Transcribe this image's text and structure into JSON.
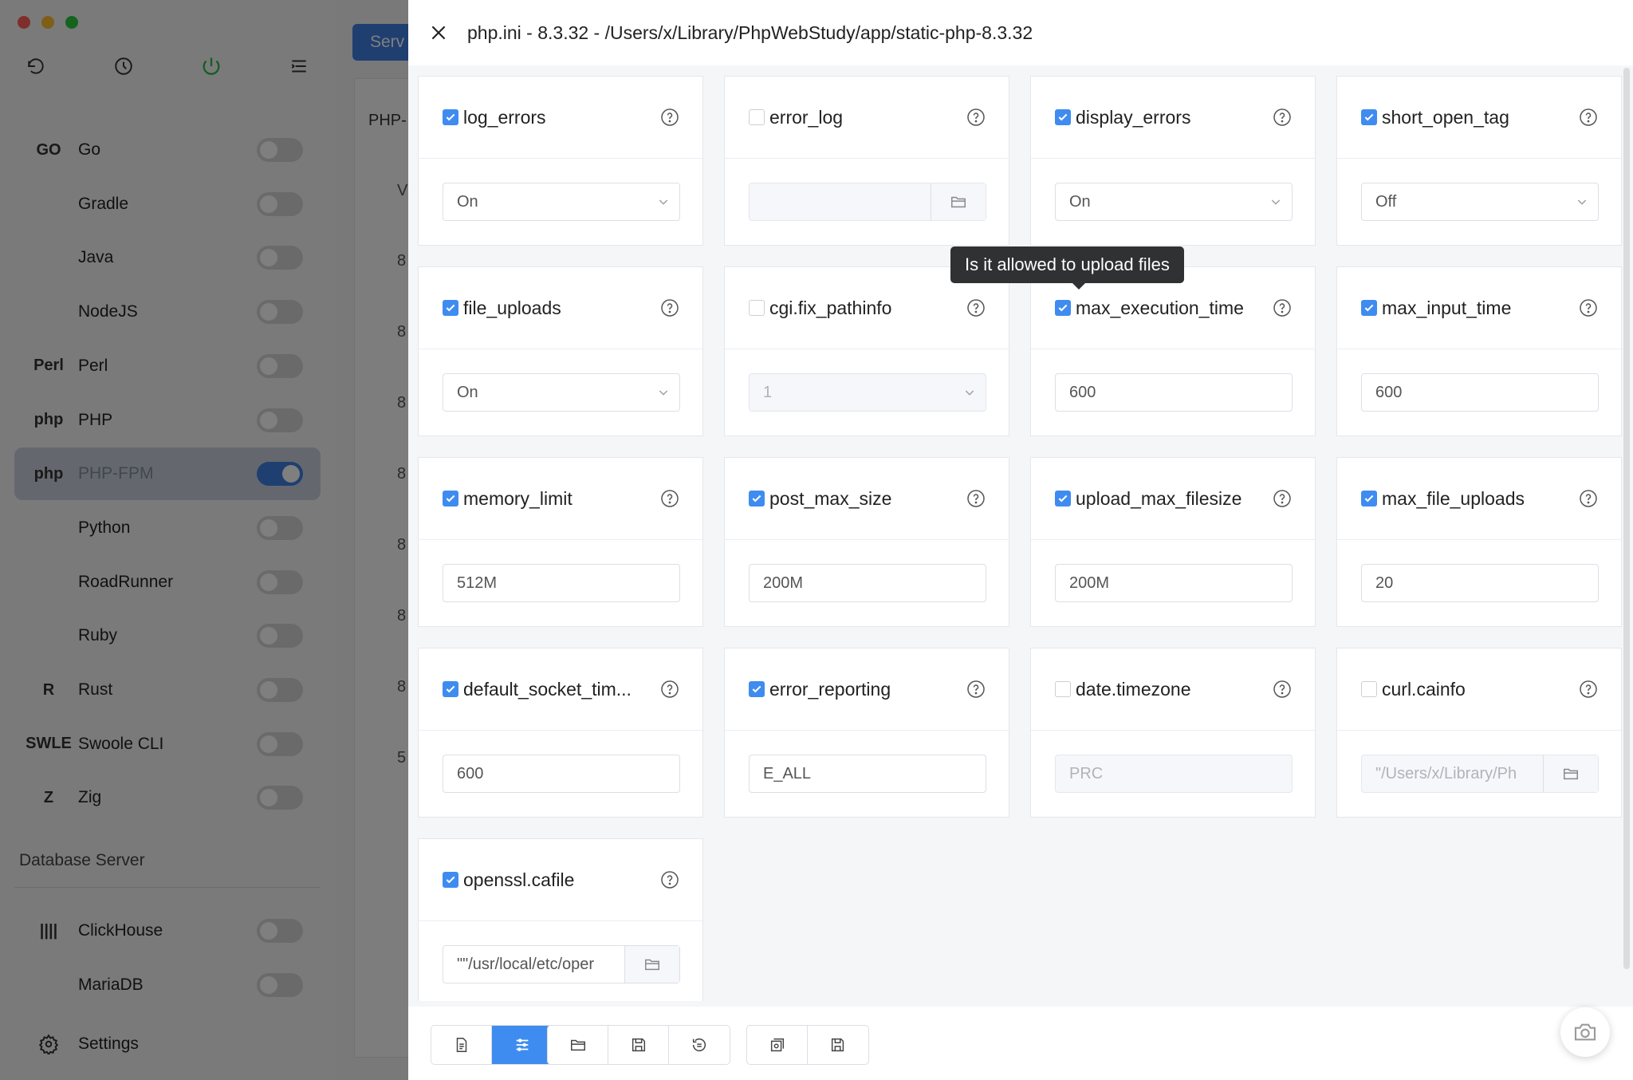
{
  "drawer": {
    "title": "php.ini - 8.3.32 - /Users/x/Library/PhpWebStudy/app/static-php-8.3.32"
  },
  "sidebar": {
    "items": [
      {
        "name": "Go",
        "icon": "go-icon",
        "icon_text": "GO",
        "active": false
      },
      {
        "name": "Gradle",
        "icon": "gradle-icon",
        "icon_text": "",
        "active": false
      },
      {
        "name": "Java",
        "icon": "java-icon",
        "icon_text": "",
        "active": false
      },
      {
        "name": "NodeJS",
        "icon": "nodejs-icon",
        "icon_text": "",
        "active": false
      },
      {
        "name": "Perl",
        "icon": "perl-icon",
        "icon_text": "Perl",
        "active": false
      },
      {
        "name": "PHP",
        "icon": "php-icon",
        "icon_text": "php",
        "active": false
      },
      {
        "name": "PHP-FPM",
        "icon": "php-fpm-icon",
        "icon_text": "php",
        "active": true
      },
      {
        "name": "Python",
        "icon": "python-icon",
        "icon_text": "",
        "active": false
      },
      {
        "name": "RoadRunner",
        "icon": "roadrunner-icon",
        "icon_text": "",
        "active": false
      },
      {
        "name": "Ruby",
        "icon": "ruby-icon",
        "icon_text": "",
        "active": false
      },
      {
        "name": "Rust",
        "icon": "rust-icon",
        "icon_text": "R",
        "active": false
      },
      {
        "name": "Swoole CLI",
        "icon": "swoole-icon",
        "icon_text": "SWLE",
        "active": false
      },
      {
        "name": "Zig",
        "icon": "zig-icon",
        "icon_text": "Z",
        "active": false
      }
    ],
    "section_database": "Database Server",
    "db_items": [
      {
        "name": "ClickHouse",
        "icon": "clickhouse-icon",
        "icon_text": "||||"
      },
      {
        "name": "MariaDB",
        "icon": "mariadb-icon",
        "icon_text": ""
      }
    ],
    "settings": "Settings"
  },
  "main": {
    "serv_button": "Serv",
    "php_tab": "PHP-",
    "column_v": "V",
    "row_values": [
      "8",
      "8",
      "8",
      "8",
      "8",
      "8",
      "8",
      "5"
    ]
  },
  "settings_cards": [
    {
      "key": "log_errors",
      "checked": true,
      "type": "select",
      "value": "On",
      "disabled": false
    },
    {
      "key": "error_log",
      "checked": false,
      "type": "file",
      "value": "",
      "disabled": true
    },
    {
      "key": "display_errors",
      "checked": true,
      "type": "select",
      "value": "On",
      "disabled": false
    },
    {
      "key": "short_open_tag",
      "checked": true,
      "type": "select",
      "value": "Off",
      "disabled": false
    },
    {
      "key": "file_uploads",
      "checked": true,
      "type": "select",
      "value": "On",
      "disabled": false
    },
    {
      "key": "cgi.fix_pathinfo",
      "checked": false,
      "type": "select",
      "value": "1",
      "disabled": true
    },
    {
      "key": "max_execution_time",
      "checked": true,
      "type": "input",
      "value": "600",
      "disabled": false
    },
    {
      "key": "max_input_time",
      "checked": true,
      "type": "input",
      "value": "600",
      "disabled": false
    },
    {
      "key": "memory_limit",
      "checked": true,
      "type": "input",
      "value": "512M",
      "disabled": false
    },
    {
      "key": "post_max_size",
      "checked": true,
      "type": "input",
      "value": "200M",
      "disabled": false
    },
    {
      "key": "upload_max_filesize",
      "checked": true,
      "type": "input",
      "value": "200M",
      "disabled": false
    },
    {
      "key": "max_file_uploads",
      "checked": true,
      "type": "input",
      "value": "20",
      "disabled": false
    },
    {
      "key": "default_socket_tim...",
      "checked": true,
      "type": "input",
      "value": "600",
      "disabled": false
    },
    {
      "key": "error_reporting",
      "checked": true,
      "type": "input",
      "value": "E_ALL",
      "disabled": false
    },
    {
      "key": "date.timezone",
      "checked": false,
      "type": "input",
      "value": "PRC",
      "disabled": true
    },
    {
      "key": "curl.cainfo",
      "checked": false,
      "type": "file",
      "value": "\"/Users/x/Library/Ph",
      "disabled": true
    },
    {
      "key": "openssl.cafile",
      "checked": true,
      "type": "file",
      "value": "\"\"/usr/local/etc/oper",
      "disabled": false
    }
  ],
  "tooltip": "Is it allowed to upload files",
  "footer_buttons": {
    "group1": [
      "file-text-icon",
      "sliders-icon"
    ],
    "group2": [
      "folder-open-icon",
      "save-icon",
      "history-icon"
    ],
    "group3": [
      "restore-icon",
      "save-as-icon"
    ]
  },
  "colors": {
    "accent": "#3f8cf0",
    "toggle_on": "#3f7fe0",
    "mac_red": "#ff5f57",
    "mac_yellow": "#febc2e",
    "mac_green": "#28c840",
    "power_green": "#2ab84a"
  }
}
